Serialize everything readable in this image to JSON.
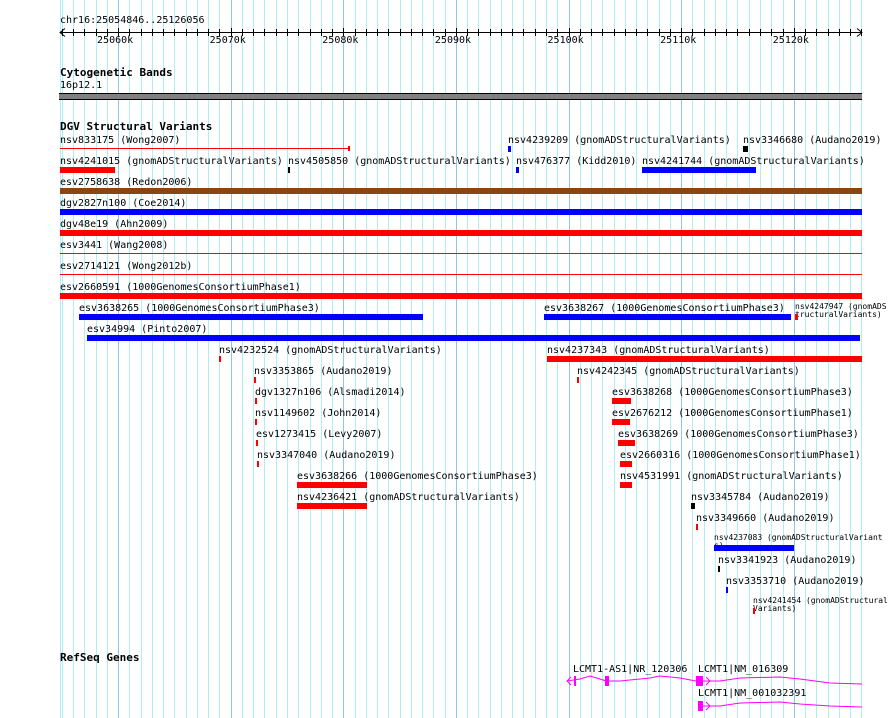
{
  "ruler": {
    "location": "chr16:25054846..25126056",
    "ticks": [
      "25060k",
      "25070k",
      "25080k",
      "25090k",
      "25100k",
      "25110k",
      "25120k"
    ]
  },
  "tracks": {
    "cytobands": {
      "title": "Cytogenetic Bands",
      "band_label": "16p12.1",
      "band_color": "#808080"
    },
    "dgv": {
      "title": "DGV Structural Variants",
      "features": [
        {
          "label": "nsv833175 (Wong2007)",
          "color": "#ff0000"
        },
        {
          "label": "nsv4239209 (gnomADStructuralVariants)",
          "color": "#0000ff"
        },
        {
          "label": "nsv3346680 (Audano2019)",
          "color": "#000000"
        },
        {
          "label": "nsv4241015 (gnomADStructuralVariants)",
          "color": "#ff0000"
        },
        {
          "label": "nsv4505850 (gnomADStructuralVariants)",
          "color": "#000000"
        },
        {
          "label": "nsv476377 (Kidd2010)",
          "color": "#0000ff"
        },
        {
          "label": "nsv4241744 (gnomADStructuralVariants)",
          "color": "#0000ff"
        },
        {
          "label": "esv2758638 (Redon2006)",
          "color": "#8b4513"
        },
        {
          "label": "dgv2827n100 (Coe2014)",
          "color": "#0000ff"
        },
        {
          "label": "dgv48e19 (Ahn2009)",
          "color": "#ff0000"
        },
        {
          "label": "esv3441 (Wang2008)",
          "color": "#ff0000"
        },
        {
          "label": "esv2714121 (Wong2012b)",
          "color": "#ff0000"
        },
        {
          "label": "esv2660591 (1000GenomesConsortiumPhase1)",
          "color": "#ff0000"
        },
        {
          "label": "esv3638265 (1000GenomesConsortiumPhase3)",
          "color": "#0000ff"
        },
        {
          "label": "esv3638267 (1000GenomesConsortiumPhase3)",
          "color": "#0000ff"
        },
        {
          "label": "nsv4247947 (gnomADStructuralVariants)",
          "color": "#ff0000"
        },
        {
          "label": "esv34994 (Pinto2007)",
          "color": "#0000ff"
        },
        {
          "label": "nsv4232524 (gnomADStructuralVariants)",
          "color": "#ff0000"
        },
        {
          "label": "nsv4237343 (gnomADStructuralVariants)",
          "color": "#ff0000"
        },
        {
          "label": "nsv3353865 (Audano2019)",
          "color": "#ff0000"
        },
        {
          "label": "nsv4242345 (gnomADStructuralVariants)",
          "color": "#ff0000"
        },
        {
          "label": "dgv1327n106 (Alsmadi2014)",
          "color": "#ff0000"
        },
        {
          "label": "esv3638268 (1000GenomesConsortiumPhase3)",
          "color": "#ff0000"
        },
        {
          "label": "nsv1149602 (John2014)",
          "color": "#ff0000"
        },
        {
          "label": "esv2676212 (1000GenomesConsortiumPhase1)",
          "color": "#ff0000"
        },
        {
          "label": "esv1273415 (Levy2007)",
          "color": "#ff0000"
        },
        {
          "label": "esv3638269 (1000GenomesConsortiumPhase3)",
          "color": "#ff0000"
        },
        {
          "label": "nsv3347040 (Audano2019)",
          "color": "#ff0000"
        },
        {
          "label": "esv2660316 (1000GenomesConsortiumPhase1)",
          "color": "#ff0000"
        },
        {
          "label": "esv3638266 (1000GenomesConsortiumPhase3)",
          "color": "#ff0000"
        },
        {
          "label": "nsv4531991 (gnomADStructuralVariants)",
          "color": "#ff0000"
        },
        {
          "label": "nsv4236421 (gnomADStructuralVariants)",
          "color": "#ff0000"
        },
        {
          "label": "nsv3345784 (Audano2019)",
          "color": "#000000"
        },
        {
          "label": "nsv3349660 (Audano2019)",
          "color": "#ff0000"
        },
        {
          "label": "nsv4237083 (gnomADStructuralVariants)",
          "color": "#0000ff"
        },
        {
          "label": "nsv3341923 (Audano2019)",
          "color": "#000000"
        },
        {
          "label": "nsv3353710 (Audano2019)",
          "color": "#0000ff"
        },
        {
          "label": "nsv4241454 (gnomADStructuralVariants)",
          "color": "#ff0000"
        }
      ]
    },
    "refseq": {
      "title": "RefSeq Genes",
      "color": "#ff00ff",
      "genes": [
        {
          "label": "LCMT1-AS1|NR_120306",
          "strand": "-"
        },
        {
          "label": "LCMT1|NM_016309",
          "strand": "+"
        },
        {
          "label": "LCMT1|NM_001032391",
          "strand": "+"
        }
      ]
    }
  }
}
